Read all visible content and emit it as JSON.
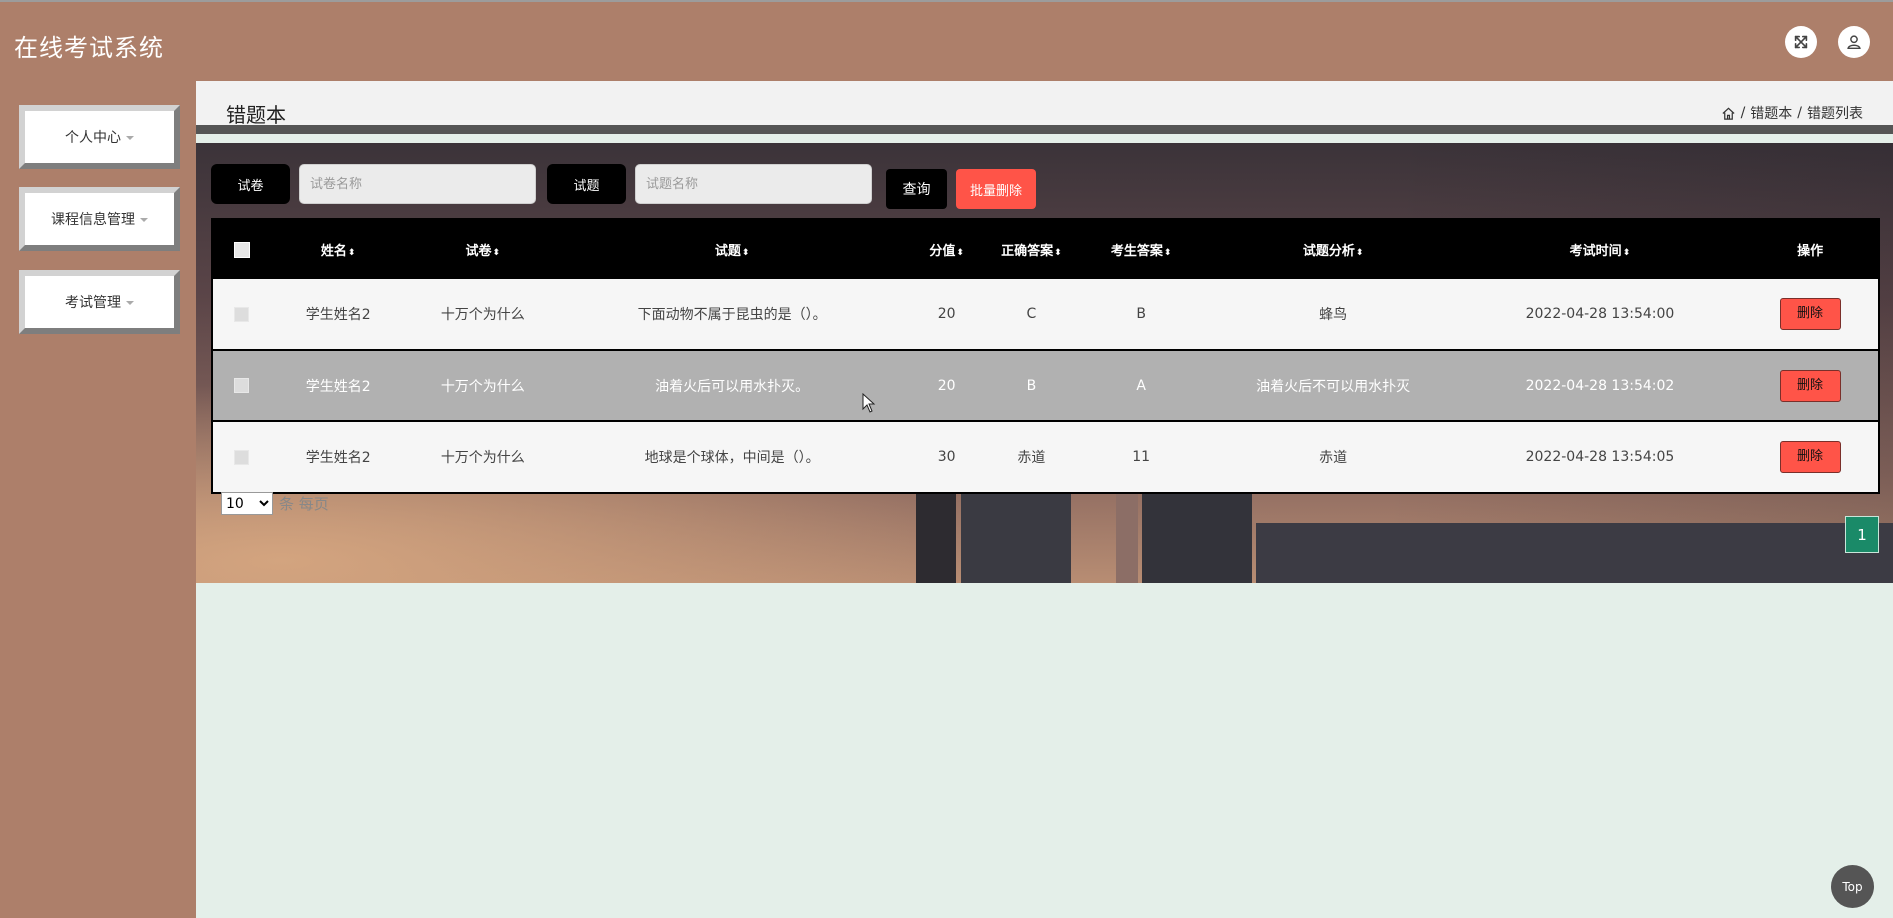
{
  "app": {
    "title": "在线考试系统"
  },
  "sidebar": {
    "items": [
      {
        "label": "个人中心"
      },
      {
        "label": "课程信息管理"
      },
      {
        "label": "考试管理"
      }
    ]
  },
  "page": {
    "title": "错题本"
  },
  "breadcrumb": {
    "items": [
      "错题本",
      "错题列表"
    ],
    "separator": "/"
  },
  "search": {
    "paper_label": "试卷",
    "paper_placeholder": "试卷名称",
    "question_label": "试题",
    "question_placeholder": "试题名称",
    "query_label": "查询",
    "batch_delete_label": "批量删除"
  },
  "table": {
    "columns": [
      "姓名",
      "试卷",
      "试题",
      "分值",
      "正确答案",
      "考生答案",
      "试题分析",
      "考试时间",
      "操作"
    ],
    "rows": [
      {
        "name": "学生姓名2",
        "paper": "十万个为什么",
        "question": "下面动物不属于昆虫的是（）。",
        "score": "20",
        "correct": "C",
        "answer": "B",
        "analysis": "蜂鸟",
        "time": "2022-04-28 13:54:00",
        "action": "删除"
      },
      {
        "name": "学生姓名2",
        "paper": "十万个为什么",
        "question": "油着火后可以用水扑灭。",
        "score": "20",
        "correct": "B",
        "answer": "A",
        "analysis": "油着火后不可以用水扑灭",
        "time": "2022-04-28 13:54:02",
        "action": "删除"
      },
      {
        "name": "学生姓名2",
        "paper": "十万个为什么",
        "question": "地球是个球体，中间是（）。",
        "score": "30",
        "correct": "赤道",
        "answer": "11",
        "analysis": "赤道",
        "time": "2022-04-28 13:54:05",
        "action": "删除"
      }
    ]
  },
  "pagination": {
    "page_size": "10",
    "per_page_label": "条 每页",
    "current_page": "1"
  },
  "back_to_top": {
    "label": "Top"
  },
  "icons": {
    "fullscreen": "fullscreen-icon",
    "user": "user-icon",
    "home": "home-icon"
  },
  "colors": {
    "header_bg": "#ad7f6a",
    "danger": "#ff5448",
    "page_active": "#1a8a68",
    "table_head": "#000000"
  }
}
